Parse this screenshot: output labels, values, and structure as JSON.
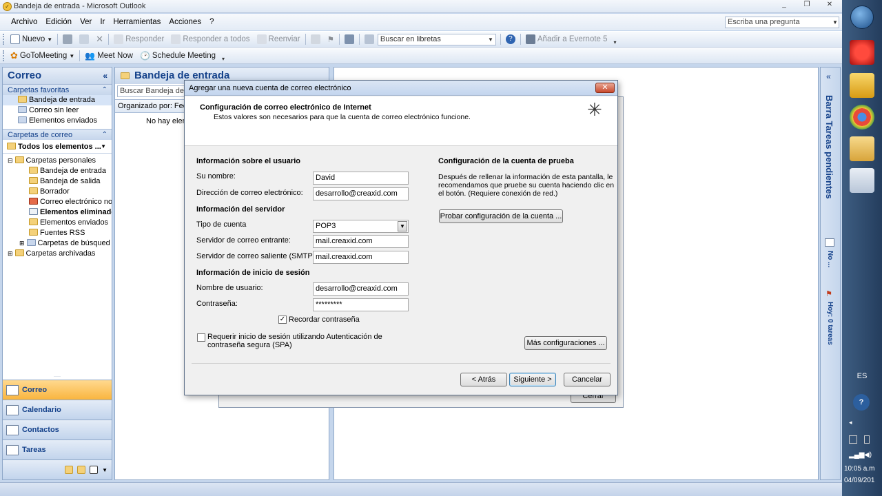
{
  "window": {
    "title": "Bandeja de entrada - Microsoft Outlook",
    "minimize": "_",
    "restore": "❐",
    "close": "✕"
  },
  "menu": {
    "items": [
      "Archivo",
      "Edición",
      "Ver",
      "Ir",
      "Herramientas",
      "Acciones",
      "?"
    ],
    "ask_placeholder": "Escriba una pregunta"
  },
  "toolbar1": {
    "new_label": "Nuevo",
    "reply_label": "Responder",
    "reply_all_label": "Responder a todos",
    "forward_label": "Reenviar",
    "search_books_placeholder": "Buscar en libretas",
    "evernote_label": "Añadir a Evernote 5"
  },
  "toolbar2": {
    "gotomeeting_label": "GoToMeeting",
    "meet_now_label": "Meet Now",
    "schedule_meeting_label": "Schedule Meeting"
  },
  "nav": {
    "header": "Correo",
    "favorites_header": "Carpetas favoritas",
    "favorites": [
      "Bandeja de entrada",
      "Correo sin leer",
      "Elementos enviados"
    ],
    "mail_folders_header": "Carpetas de correo",
    "all_items_label": "Todos los elementos ...",
    "personal_folders": "Carpetas personales",
    "folders": [
      "Bandeja de entrada",
      "Bandeja de salida",
      "Borrador",
      "Correo electrónico no",
      "Elementos eliminados",
      "Elementos enviados",
      "Fuentes RSS",
      "Carpetas de búsqued"
    ],
    "archived_folders": "Carpetas archivadas",
    "buttons": [
      "Correo",
      "Calendario",
      "Contactos",
      "Tareas"
    ]
  },
  "listpane": {
    "header": "Bandeja de entrada",
    "search_placeholder": "Buscar Bandeja de e",
    "arranged_by": "Organizado por: Fec",
    "empty_text": "No hay elem",
    "behind_close": "Cerrar"
  },
  "todobar": {
    "title": "Barra Tareas pendientes",
    "no_label": "No ...",
    "today_label": "Hoy: 0 tareas"
  },
  "taskbar": {
    "lang": "ES",
    "time": "10:05 a.m",
    "date": "04/09/201"
  },
  "dialog": {
    "title": "Agregar una nueva cuenta de correo electrónico",
    "close": "✕",
    "heading": "Configuración de correo electrónico de Internet",
    "subheading": "Estos valores son necesarios para que la cuenta de correo electrónico funcione.",
    "user_info_header": "Información sobre el usuario",
    "name_label": "Su nombre:",
    "name_value": "David",
    "email_label": "Dirección de correo electrónico:",
    "email_value": "desarrollo@creaxid.com",
    "server_info_header": "Información del servidor",
    "account_type_label": "Tipo de cuenta",
    "account_type_value": "POP3",
    "incoming_label": "Servidor de correo entrante:",
    "incoming_value": "mail.creaxid.com",
    "outgoing_label": "Servidor de correo saliente (SMTP):",
    "outgoing_value": "mail.creaxid.com",
    "logon_header": "Información de inicio de sesión",
    "username_label": "Nombre de usuario:",
    "username_value": "desarrollo@creaxid.com",
    "password_label": "Contraseña:",
    "password_value": "*********",
    "remember_label": "Recordar contraseña",
    "spa_label_line1": "Requerir inicio de sesión utilizando Autenticación de",
    "spa_label_line2": "contraseña segura (SPA)",
    "test_header": "Configuración de la cuenta de prueba",
    "test_desc_line1": "Después de rellenar la información de esta pantalla, le",
    "test_desc_line2": "recomendamos que pruebe su cuenta haciendo clic en",
    "test_desc_line3": "el botón. (Requiere conexión de red.)",
    "test_button": "Probar configuración de la cuenta ...",
    "more_settings_button": "Más configuraciones ...",
    "back_button": "< Atrás",
    "next_button": "Siguiente >",
    "cancel_button": "Cancelar"
  }
}
